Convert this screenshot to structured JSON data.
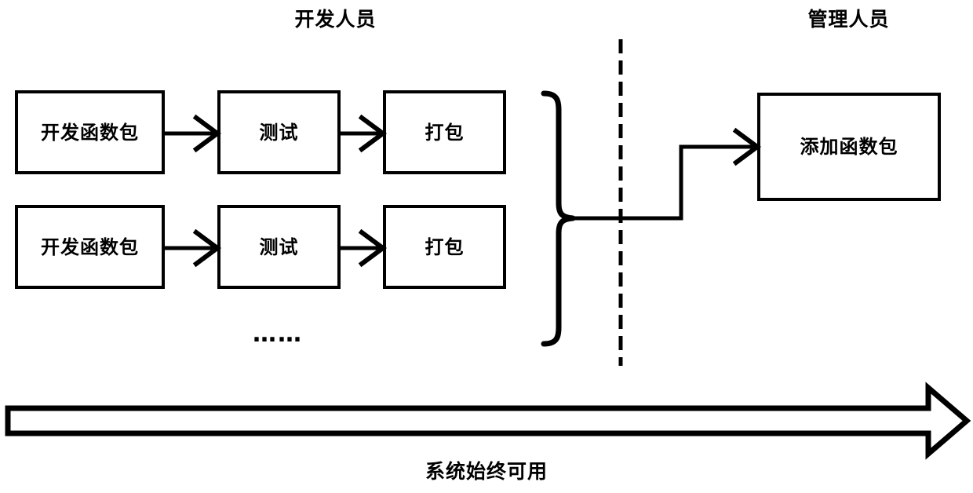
{
  "diagram": {
    "title_left": "开发人员",
    "title_right": "管理人员",
    "caption": "系统始终可用",
    "ellipsis": "……",
    "line_color": "#000000",
    "background_color": "#ffffff",
    "developer_rows": [
      {
        "steps": [
          {
            "label": "开发函数包"
          },
          {
            "label": "测试"
          },
          {
            "label": "打包"
          }
        ]
      },
      {
        "steps": [
          {
            "label": "开发函数包"
          },
          {
            "label": "测试"
          },
          {
            "label": "打包"
          }
        ]
      }
    ],
    "manager_node": {
      "label": "添加函数包"
    },
    "separator": {
      "style": "dashed",
      "orientation": "vertical"
    },
    "aggregator": {
      "glyph": "right-curly-brace"
    },
    "timeline_arrow": {
      "direction": "right",
      "style": "hollow-block-arrow"
    }
  }
}
